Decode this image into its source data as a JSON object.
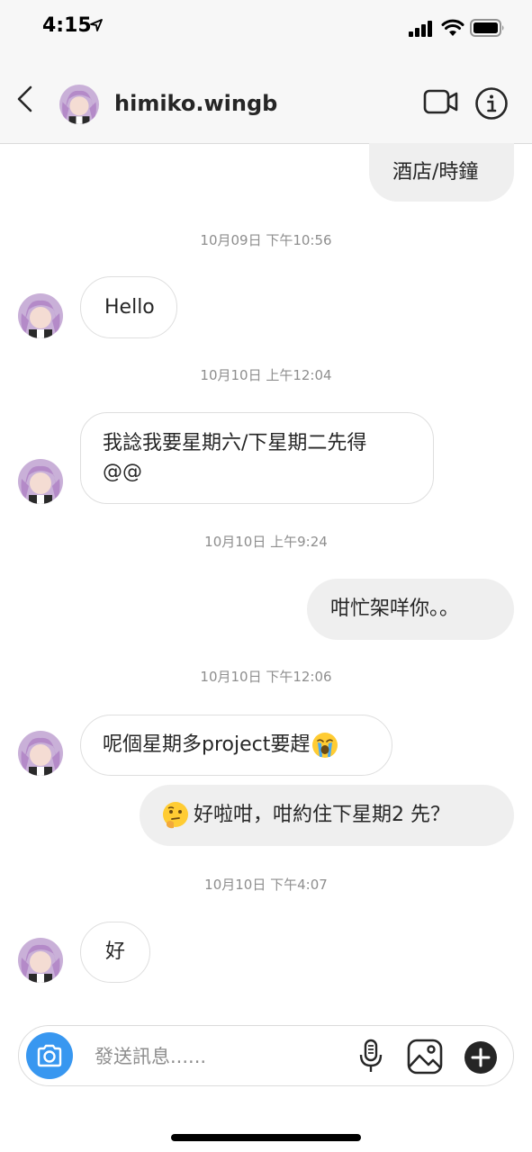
{
  "status_bar": {
    "time": "4:15"
  },
  "header": {
    "username": "himiko.wingb"
  },
  "messages": {
    "m0": "酒店/時鐘",
    "ts1": "10月09日 下午10:56",
    "m1": "Hello",
    "ts2": "10月10日 上午12:04",
    "m2_line1": "我諗我要星期六/下星期二先得",
    "m2_line2": "@@",
    "ts3": "10月10日 上午9:24",
    "m3": "咁忙架咩你。。",
    "ts4": "10月10日 下午12:06",
    "m4": "呢個星期多project要趕",
    "m5": "好啦咁，咁約住下星期2 先？",
    "ts5": "10月10日 下午4:07",
    "m6": "好"
  },
  "composer": {
    "placeholder": "發送訊息......"
  },
  "colors": {
    "outgoing_bubble": "#efefef",
    "incoming_border": "#dedede",
    "camera_button": "#3897f0",
    "timestamp": "#8e8e8e"
  },
  "icons": {
    "back": "chevron-left-icon",
    "video": "video-camera-icon",
    "info": "info-icon",
    "camera": "camera-icon",
    "mic": "microphone-icon",
    "gallery": "image-icon",
    "plus": "plus-circle-icon"
  }
}
